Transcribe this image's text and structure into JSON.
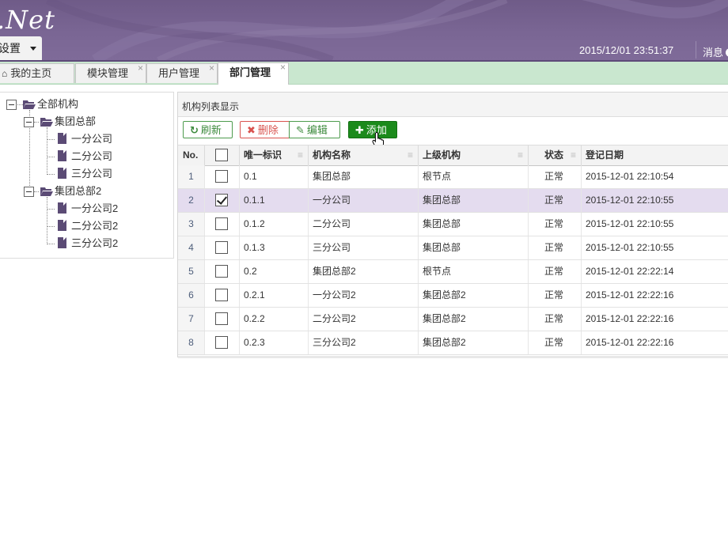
{
  "header": {
    "logo": ".Net",
    "settings_label": "设置",
    "datetime": "2015/12/01 23:51:37",
    "messages_label": "消息"
  },
  "tabs": [
    {
      "label": "我的主页",
      "icon": "home-icon",
      "closable": false
    },
    {
      "label": "模块管理",
      "closable": true
    },
    {
      "label": "用户管理",
      "closable": true
    },
    {
      "label": "部门管理",
      "closable": true,
      "active": true
    }
  ],
  "tree": {
    "root": "全部机构",
    "groups": [
      {
        "label": "集团总部",
        "children": [
          "一分公司",
          "二分公司",
          "三分公司"
        ]
      },
      {
        "label": "集团总部2",
        "children": [
          "一分公司2",
          "二分公司2",
          "三分公司2"
        ]
      }
    ]
  },
  "grid": {
    "title": "机构列表显示",
    "buttons": {
      "refresh": "刷新",
      "delete": "删除",
      "edit": "编辑",
      "add": "添加"
    },
    "columns": [
      "No.",
      "",
      "唯一标识",
      "机构名称",
      "上级机构",
      "状态",
      "登记日期"
    ],
    "rows": [
      {
        "no": "1",
        "checked": false,
        "id": "0.1",
        "name": "集团总部",
        "parent": "根节点",
        "status": "正常",
        "date": "2015-12-01 22:10:54"
      },
      {
        "no": "2",
        "checked": true,
        "id": "0.1.1",
        "name": "一分公司",
        "parent": "集团总部",
        "status": "正常",
        "date": "2015-12-01 22:10:55"
      },
      {
        "no": "3",
        "checked": false,
        "id": "0.1.2",
        "name": "二分公司",
        "parent": "集团总部",
        "status": "正常",
        "date": "2015-12-01 22:10:55"
      },
      {
        "no": "4",
        "checked": false,
        "id": "0.1.3",
        "name": "三分公司",
        "parent": "集团总部",
        "status": "正常",
        "date": "2015-12-01 22:10:55"
      },
      {
        "no": "5",
        "checked": false,
        "id": "0.2",
        "name": "集团总部2",
        "parent": "根节点",
        "status": "正常",
        "date": "2015-12-01 22:22:14"
      },
      {
        "no": "6",
        "checked": false,
        "id": "0.2.1",
        "name": "一分公司2",
        "parent": "集团总部2",
        "status": "正常",
        "date": "2015-12-01 22:22:16"
      },
      {
        "no": "7",
        "checked": false,
        "id": "0.2.2",
        "name": "二分公司2",
        "parent": "集团总部2",
        "status": "正常",
        "date": "2015-12-01 22:22:16"
      },
      {
        "no": "8",
        "checked": false,
        "id": "0.2.3",
        "name": "三分公司2",
        "parent": "集团总部2",
        "status": "正常",
        "date": "2015-12-01 22:22:16"
      }
    ]
  },
  "colors": {
    "header": "#7a6694",
    "tabbar": "#c9e7cf",
    "selected_row": "#e4dcef",
    "add_button": "#1b8a1b"
  }
}
